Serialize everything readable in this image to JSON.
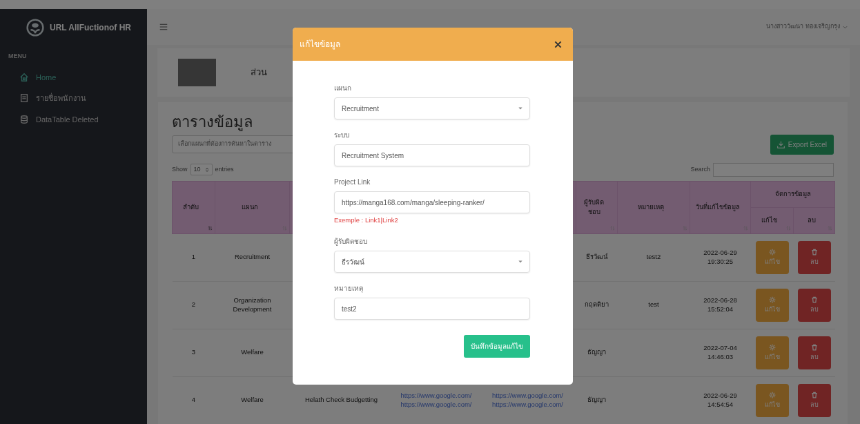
{
  "sidebar": {
    "brand": "URL AllFuctionof HR",
    "menu_label": "MENU",
    "items": [
      {
        "label": "Home",
        "selected": true
      },
      {
        "label": "รายชื่อพนักงาน",
        "selected": false
      },
      {
        "label": "DataTable Deleted",
        "selected": false
      }
    ]
  },
  "topbar": {
    "user": "นางสาววัฒนา ทองเจริญกรุง"
  },
  "profile": {
    "text": "ส่วน"
  },
  "table_card": {
    "title": "ตารางข้อมูล",
    "filter_placeholder": "เลือกแผนกที่ต้องการค้นหาในตาราง",
    "export_button": "Export Excel",
    "show_label": "Show",
    "page_size": "10",
    "entries_label": "entries",
    "search_label": "Search",
    "columns": [
      {
        "label": "ลำดับ",
        "sorted": true
      },
      {
        "label": "แผนก",
        "sorted": false
      },
      {
        "label": "ผู้รับผิดชอบ",
        "sorted": false
      },
      {
        "label": "หมายเหตุ",
        "sorted": false
      },
      {
        "label": "วันที่แก้ไขข้อมูล",
        "sorted": false
      },
      {
        "label": "จัดการข้อมูล",
        "children": [
          {
            "label": "แก้ไข",
            "sorted": false
          },
          {
            "label": "ลบ",
            "sorted": false
          }
        ]
      }
    ],
    "rows": [
      {
        "no": "1",
        "department": "Recruitment",
        "responsible": "ธีรวัฒน์",
        "note": "test2",
        "modified": "2022-06-29 19:30:25",
        "edit": "แก้ไข",
        "delete": "ลบ"
      },
      {
        "no": "2",
        "department": "Organization Development",
        "responsible": "กฤตติยา",
        "note": "test",
        "modified": "2022-06-28 15:52:04",
        "edit": "แก้ไข",
        "delete": "ลบ"
      },
      {
        "no": "3",
        "department": "Welfare",
        "responsible": "ธัญญา",
        "modified": "2022-07-04 14:46:03",
        "edit": "แก้ไข",
        "delete": "ลบ"
      },
      {
        "no": "4",
        "department": "Welfare",
        "column_3": "Helath Check Budgetting",
        "column_4": [
          "https://www.google.com/",
          "https://www.google.com/"
        ],
        "column_5": [
          "https://www.google.com/",
          "https://www.google.com/"
        ],
        "responsible": "ธัญญา",
        "modified": "2022-06-29 14:54:54",
        "edit": "แก้ไข",
        "delete": "ลบ"
      }
    ]
  },
  "modal": {
    "title": "แก้ไขข้อมูล",
    "fields": [
      {
        "kind": "select",
        "label": "แผนก",
        "value": "Recruitment"
      },
      {
        "kind": "text",
        "label": "ระบบ",
        "value": "Recruitment System"
      },
      {
        "kind": "text",
        "label": "Project Link",
        "value": "https://manga168.com/manga/sleeping-ranker/",
        "help": "Exemple : Link1|Link2"
      },
      {
        "kind": "select",
        "label": "ผู้รับผิดชอบ",
        "value": "ธีรวัฒน์"
      },
      {
        "kind": "text",
        "label": "หมายเหตุ",
        "value": "test2"
      }
    ],
    "submit": "บันทึกข้อมูลแก้ไข"
  }
}
